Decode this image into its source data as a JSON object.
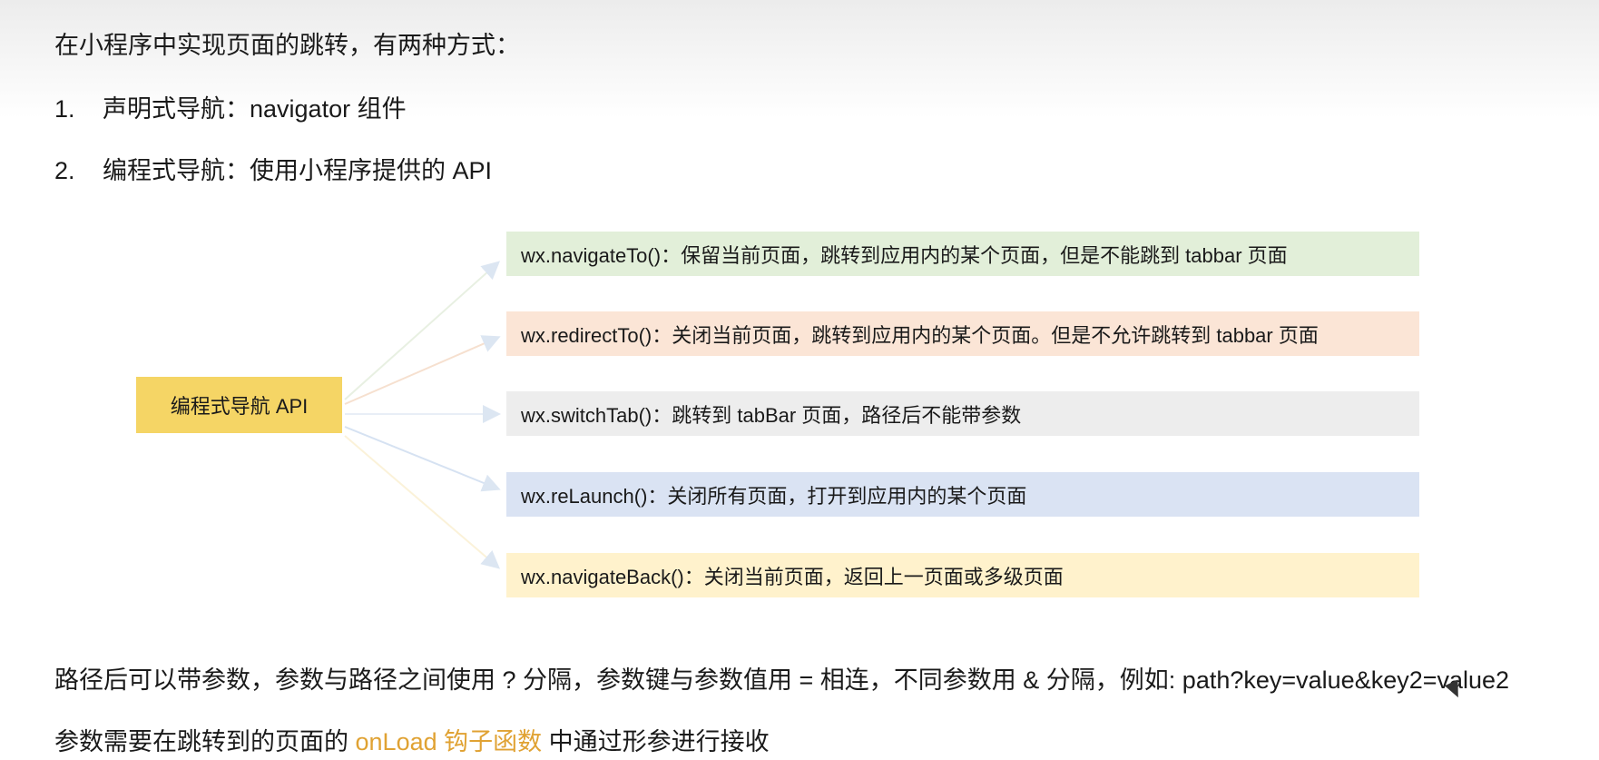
{
  "intro": "在小程序中实现页面的跳转，有两种方式：",
  "items": [
    {
      "num": "1.",
      "text": "声明式导航：navigator 组件"
    },
    {
      "num": "2.",
      "text": "编程式导航：使用小程序提供的 API"
    }
  ],
  "diagram": {
    "root": "编程式导航 API",
    "branches": [
      {
        "text": "wx.navigateTo()：保留当前页面，跳转到应用内的某个页面，但是不能跳到 tabbar 页面",
        "color": "#e2efd9"
      },
      {
        "text": "wx.redirectTo()：关闭当前页面，跳转到应用内的某个页面。但是不允许跳转到 tabbar 页面",
        "color": "#fbe5d6"
      },
      {
        "text": "wx.switchTab()：跳转到 tabBar 页面，路径后不能带参数",
        "color": "#ededed"
      },
      {
        "text": "wx.reLaunch()：关闭所有页面，打开到应用内的某个页面",
        "color": "#dae3f3"
      },
      {
        "text": "wx.navigateBack()：关闭当前页面，返回上一页面或多级页面",
        "color": "#fff2cc"
      }
    ]
  },
  "note1": "路径后可以带参数，参数与路径之间使用 ? 分隔，参数键与参数值用 = 相连，不同参数用 & 分隔，例如: path?key=value&key2=value2",
  "note2": {
    "before": "参数需要在跳转到的页面的 ",
    "highlight": "onLoad 钩子函数",
    "after": " 中通过形参进行接收"
  },
  "highlight_color": "#e0a233"
}
